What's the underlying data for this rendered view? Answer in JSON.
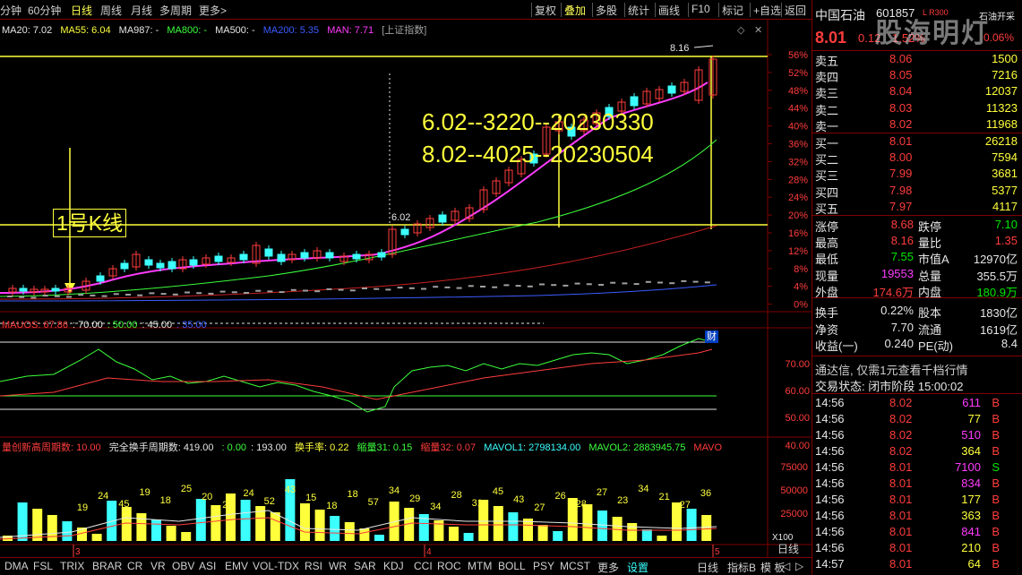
{
  "toolbar": {
    "left_items": [
      "分钟",
      "60分钟",
      "日线",
      "周线",
      "月线",
      "多周期",
      "更多>"
    ],
    "active_index": 2,
    "right_items": [
      "复权",
      "叠加",
      "多股",
      "统计",
      "画线",
      "F10",
      "标记",
      "+自选",
      "返回"
    ],
    "right_active_index": 1
  },
  "ma_line": {
    "ma20": "MA20: 7.02",
    "ma55": "MA55: 6.04",
    "ma987": "MA987: -",
    "ma800": "MA800: -",
    "ma500": "MA500: -",
    "ma200": "MA200: 5.35",
    "man": "MAN: 7.71",
    "overlay": "[上证指数]"
  },
  "annotations": {
    "kline_label": "1号K线",
    "note1": "6.02--3220--20230330",
    "note2": "8.02--4025--20230504",
    "peak_label": "8.16",
    "low_label": "6.02",
    "cai_badge": "财"
  },
  "price_axis": [
    "56%",
    "52%",
    "48%",
    "44%",
    "40%",
    "36%",
    "32%",
    "28%",
    "24%",
    "20%",
    "16%",
    "12%",
    "8%",
    "4%",
    "0%"
  ],
  "mauos_line": {
    "title": "MAUOS: 67.86",
    "v1": ": 70.00",
    "v2": ": 50.00",
    "v3": ": 45.00",
    "v4": ": 35.00"
  },
  "mauos_axis": [
    "70.00",
    "60.00",
    "50.00",
    "40.00"
  ],
  "vol_line": {
    "a": "量创新高周期数: 10.00",
    "b": "完全换手周期数: 419.00",
    "c": ": 0.00",
    "d": ": 193.00",
    "e": "换手率: 0.22",
    "f": "缩量31: 0.15",
    "g": "缩量32: 0.07",
    "h": "MAVOL1: 2798134.00",
    "i": "MAVOL2: 2883945.75",
    "j": "MAVO"
  },
  "vol_axis": [
    "75000",
    "50000",
    "25000"
  ],
  "vol_unit": "X100",
  "month_marks": [
    "3",
    "4",
    "5"
  ],
  "bottom_tabs": [
    "DMA",
    "FSL",
    "TRIX",
    "BRAR",
    "CR",
    "VR",
    "OBV",
    "ASI",
    "EMV",
    "VOL-TDX",
    "RSI",
    "WR",
    "SAR",
    "KDJ",
    "CCI",
    "ROC",
    "MTM",
    "BOLL",
    "PSY",
    "MCST",
    "更多",
    "设置"
  ],
  "bottom_right_tabs": [
    "日线",
    "指标B",
    "模 板"
  ],
  "stock": {
    "name": "中国石油",
    "code": "601857",
    "tag": "L R300",
    "sub": "石油开采",
    "price": "8.01",
    "change": "0.12",
    "pct": "1.52%",
    "pct2": "0.06%"
  },
  "asks": [
    {
      "label": "卖五",
      "price": "8.06",
      "vol": "1500"
    },
    {
      "label": "卖四",
      "price": "8.05",
      "vol": "7216"
    },
    {
      "label": "卖三",
      "price": "8.04",
      "vol": "12037"
    },
    {
      "label": "卖二",
      "price": "8.03",
      "vol": "11323"
    },
    {
      "label": "卖一",
      "price": "8.02",
      "vol": "11968"
    }
  ],
  "bids": [
    {
      "label": "买一",
      "price": "8.01",
      "vol": "26218"
    },
    {
      "label": "买二",
      "price": "8.00",
      "vol": "7594"
    },
    {
      "label": "买三",
      "price": "7.99",
      "vol": "3681"
    },
    {
      "label": "买四",
      "price": "7.98",
      "vol": "5377"
    },
    {
      "label": "买五",
      "price": "7.97",
      "vol": "4117"
    }
  ],
  "stats": [
    {
      "l1": "涨停",
      "v1": "8.68",
      "c1": "red",
      "l2": "跌停",
      "v2": "7.10",
      "c2": "green"
    },
    {
      "l1": "最高",
      "v1": "8.16",
      "c1": "red",
      "l2": "量比",
      "v2": "1.35",
      "c2": "red"
    },
    {
      "l1": "最低",
      "v1": "7.55",
      "c1": "green",
      "l2": "市值A",
      "v2": "12970亿",
      "c2": "white"
    },
    {
      "l1": "现量",
      "v1": "19553",
      "c1": "magenta",
      "l2": "总量",
      "v2": "355.5万",
      "c2": "white"
    },
    {
      "l1": "外盘",
      "v1": "174.6万",
      "c1": "red",
      "l2": "内盘",
      "v2": "180.9万",
      "c2": "green"
    }
  ],
  "stats2": [
    {
      "l1": "换手",
      "v1": "0.22%",
      "l2": "股本",
      "v2": "1830亿"
    },
    {
      "l1": "净资",
      "v1": "7.70",
      "l2": "流通",
      "v2": "1619亿"
    },
    {
      "l1": "收益(一)",
      "v1": "0.240",
      "l2": "PE(动)",
      "v2": "8.4"
    }
  ],
  "promo": "通达信, 仅需1元查看千档行情",
  "trade_status": "交易状态: 闭市阶段 15:00:02",
  "ticks": [
    {
      "time": "14:56",
      "price": "8.02",
      "vol": "611",
      "side": "B"
    },
    {
      "time": "14:56",
      "price": "8.02",
      "vol": "77",
      "side": "B"
    },
    {
      "time": "14:56",
      "price": "8.02",
      "vol": "510",
      "side": "B"
    },
    {
      "time": "14:56",
      "price": "8.02",
      "vol": "364",
      "side": "B"
    },
    {
      "time": "14:56",
      "price": "8.01",
      "vol": "7100",
      "side": "S"
    },
    {
      "time": "14:56",
      "price": "8.01",
      "vol": "834",
      "side": "B"
    },
    {
      "time": "14:56",
      "price": "8.01",
      "vol": "177",
      "side": "B"
    },
    {
      "time": "14:56",
      "price": "8.01",
      "vol": "363",
      "side": "B"
    },
    {
      "time": "14:56",
      "price": "8.01",
      "vol": "841",
      "side": "B"
    },
    {
      "time": "14:56",
      "price": "8.01",
      "vol": "210",
      "side": "B"
    },
    {
      "time": "14:57",
      "price": "8.01",
      "vol": "64",
      "side": "B"
    }
  ],
  "watermark": "股海明灯",
  "vol_labels": [
    "19",
    "24",
    "45",
    "19",
    "18",
    "25",
    "20",
    "22",
    "24",
    "52",
    "43",
    "15",
    "18",
    "18",
    "57",
    "34",
    "29",
    "34",
    "28",
    "31",
    "45",
    "43",
    "27",
    "26",
    "28",
    "27",
    "23",
    "34",
    "21",
    "27",
    "36"
  ]
}
